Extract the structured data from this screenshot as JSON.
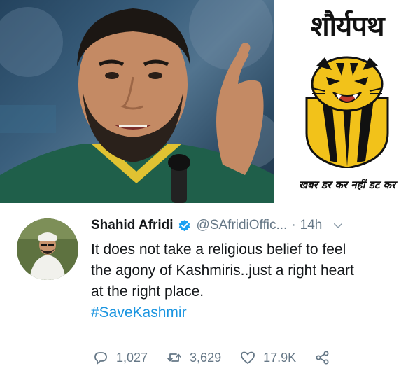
{
  "brand": {
    "title": "शौर्यपथ",
    "tagline": "खबर डर कर नहीं डट कर"
  },
  "tweet": {
    "author_name": "Shahid Afridi",
    "handle": "@SAfridiOffic...",
    "separator": "·",
    "time": "14h",
    "text_lines": [
      "It does not take a religious belief to feel",
      "the agony of Kashmiris..just a right heart",
      "at the right place."
    ],
    "hashtag": "#SaveKashmir",
    "replies": "1,027",
    "retweets": "3,629",
    "likes": "17.9K"
  },
  "colors": {
    "link_blue": "#1b95e0",
    "verified_blue": "#1da1f2",
    "muted_gray": "#657786",
    "tiger_yellow": "#f2c21a"
  },
  "icons": {
    "verified": "verified-badge-icon",
    "more": "chevron-down-icon",
    "reply": "reply-icon",
    "retweet": "retweet-icon",
    "like": "heart-icon",
    "share": "share-icon"
  }
}
